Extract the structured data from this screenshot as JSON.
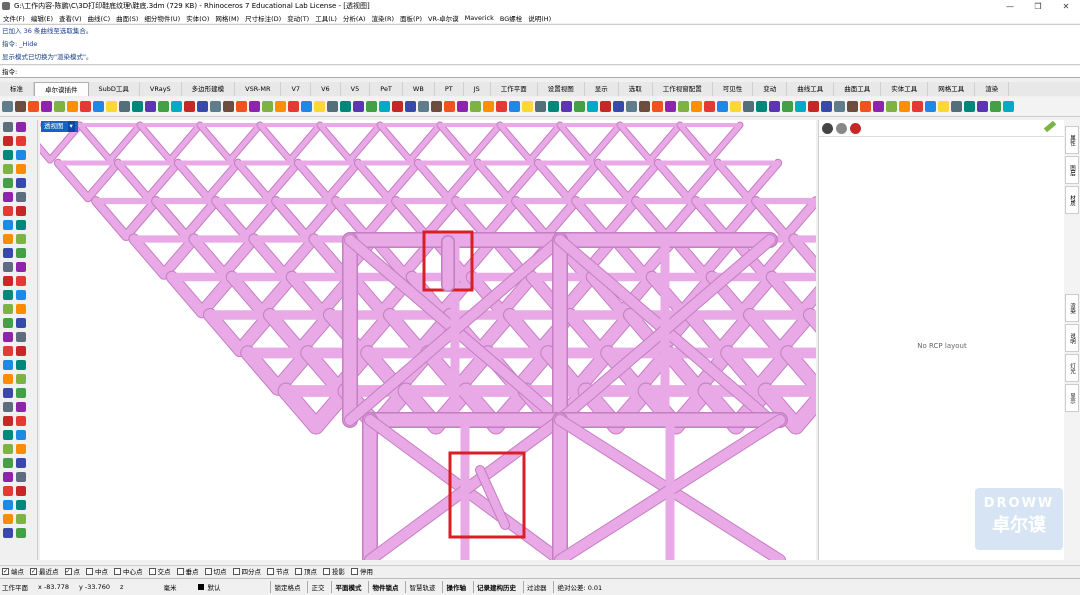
{
  "window": {
    "title": "G:\\工作内容-陈鹏\\C\\3D打印鞋底纹理\\鞋底.3dm (729 KB) - Rhinoceros 7 Educational Lab License - [透视图]",
    "minimize": "—",
    "maximize": "❐",
    "close": "✕"
  },
  "menu": [
    "文件(F)",
    "编辑(E)",
    "查看(V)",
    "曲线(C)",
    "曲面(S)",
    "细分物件(U)",
    "实体(O)",
    "网格(M)",
    "尺寸标注(D)",
    "变动(T)",
    "工具(L)",
    "分析(A)",
    "渲染(R)",
    "面板(P)",
    "VR-卓尔谟",
    "Maverick",
    "BG螺栓",
    "说明(H)"
  ],
  "command_history": [
    "已加入 36 条曲线至选取集合。",
    "指令: _Hide",
    "显示模式已切换为\"渲染模式\"。"
  ],
  "command_prompt": "指令:",
  "tabs": [
    "标准",
    "卓尔谟插件",
    "SubD工具",
    "VRayS",
    "多边形建模",
    "VSR-MR",
    "V7",
    "V6",
    "V5",
    "PeT",
    "WB",
    "PT",
    "JS",
    "工作平面",
    "设置视图",
    "显示",
    "选取",
    "工作视窗配置",
    "可见性",
    "变动",
    "曲线工具",
    "曲面工具",
    "实体工具",
    "网格工具",
    "渲染"
  ],
  "active_tab_index": 1,
  "viewport": {
    "label": "透视图",
    "label_arrow": "▾"
  },
  "right_panel": {
    "message": "No RCP layout"
  },
  "side_tabs": [
    "属性",
    "图层",
    "材质",
    "渲染",
    "说明",
    "灯光",
    "显示"
  ],
  "osnap": {
    "items": [
      {
        "label": "端点",
        "checked": true
      },
      {
        "label": "最近点",
        "checked": true
      },
      {
        "label": "点",
        "checked": true
      },
      {
        "label": "中点",
        "checked": false
      },
      {
        "label": "中心点",
        "checked": false
      },
      {
        "label": "交点",
        "checked": false
      },
      {
        "label": "垂点",
        "checked": false
      },
      {
        "label": "切点",
        "checked": false
      },
      {
        "label": "四分点",
        "checked": false
      },
      {
        "label": "节点",
        "checked": false
      },
      {
        "label": "顶点",
        "checked": false
      },
      {
        "label": "投影",
        "checked": false
      },
      {
        "label": "停用",
        "checked": false
      }
    ]
  },
  "status": {
    "cplane": "工作平面",
    "x": "x -83.778",
    "y": "y -33.760",
    "z": "z",
    "units": "毫米",
    "layer": "默认",
    "panels": [
      "锁定格点",
      "正交",
      "平面模式",
      "物件锁点",
      "智慧轨迹",
      "操作轴",
      "记录建构历史",
      "过滤器",
      "绝对公差: 0.01"
    ]
  },
  "watermark": {
    "top": "DROWW",
    "bottom": "卓尔谟"
  },
  "colors": {
    "accent": "#1565c0",
    "lattice": "#e9a8e6",
    "highlight_box": "#d81f26"
  }
}
